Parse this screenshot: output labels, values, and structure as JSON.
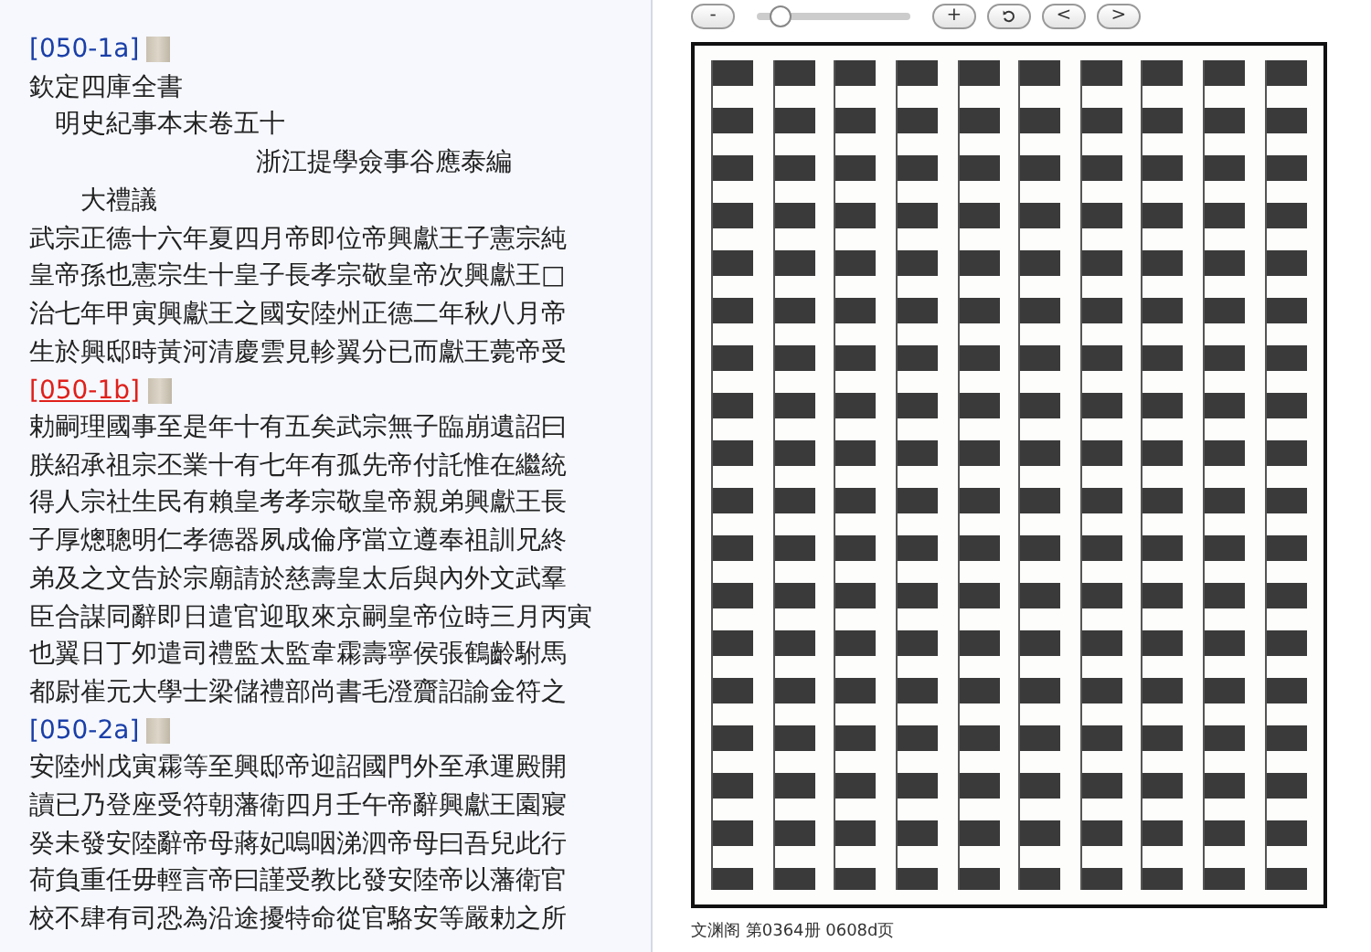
{
  "text_panel": {
    "blocks": [
      {
        "kind": "link",
        "label": "[050-1a]",
        "color": "#1a3fa8",
        "visited": false
      },
      {
        "kind": "line",
        "text": "欽定四庫全書"
      },
      {
        "kind": "title",
        "text": "明史紀事本末卷五十"
      },
      {
        "kind": "author",
        "text": "浙江提學僉事谷應泰編"
      },
      {
        "kind": "subtitle",
        "text": "大禮議"
      },
      {
        "kind": "line",
        "text": "武宗正德十六年夏四月帝即位帝興獻王子憲宗純"
      },
      {
        "kind": "line",
        "text": "皇帝孫也憲宗生十皇子長孝宗敬皇帝次興獻王□"
      },
      {
        "kind": "line",
        "text": "治七年甲寅興獻王之國安陸州正德二年秋八月帝"
      },
      {
        "kind": "line",
        "text": "生於興邸時黃河清慶雲見軫翼分已而獻王薨帝受"
      },
      {
        "kind": "link",
        "label": "[050-1b]",
        "color": "#e0201b",
        "visited": true
      },
      {
        "kind": "line",
        "text": "勅嗣理國事至是年十有五矣武宗無子臨崩遺詔曰"
      },
      {
        "kind": "line",
        "text": "朕紹承祖宗丕業十有七年有孤先帝付託惟在繼統"
      },
      {
        "kind": "line",
        "text": "得人宗社生民有賴皇考孝宗敬皇帝親弟興獻王長"
      },
      {
        "kind": "line",
        "text": "子厚熜聰明仁孝德器夙成倫序當立遵奉祖訓兄終"
      },
      {
        "kind": "line",
        "text": "弟及之文告於宗廟請於慈壽皇太后與內外文武羣"
      },
      {
        "kind": "line",
        "text": "臣合謀同辭即日遣官迎取來京嗣皇帝位時三月丙寅"
      },
      {
        "kind": "line",
        "text": "也翼日丁夘遣司禮監太監韋霦壽寧侯張鶴齡駙馬"
      },
      {
        "kind": "line",
        "text": "都尉崔元大學士梁儲禮部尚書毛澄齎詔諭金符之"
      },
      {
        "kind": "link",
        "label": "[050-2a]",
        "color": "#1a3fa8",
        "visited": false
      },
      {
        "kind": "line",
        "text": "安陸州戊寅霦等至興邸帝迎詔國門外至承運殿開"
      },
      {
        "kind": "line",
        "text": "讀已乃登座受符朝藩衛四月壬午帝辭興獻王園寢"
      },
      {
        "kind": "line",
        "text": "癸未發安陸辭帝母蔣妃嗚咽涕泗帝母曰吾兒此行"
      },
      {
        "kind": "line",
        "text": "荷負重任毋輕言帝曰謹受教比發安陸帝以藩衛官"
      },
      {
        "kind": "line",
        "text": "校不肆有司恐為沿途擾特命從官駱安等嚴勅之所"
      }
    ]
  },
  "viewer": {
    "zoom_out": "-",
    "zoom": {
      "level": 0.15
    },
    "zoom_in": "+",
    "previous": "<",
    "next": ">",
    "caption": "文渊阁 第0364册 0608d页"
  }
}
